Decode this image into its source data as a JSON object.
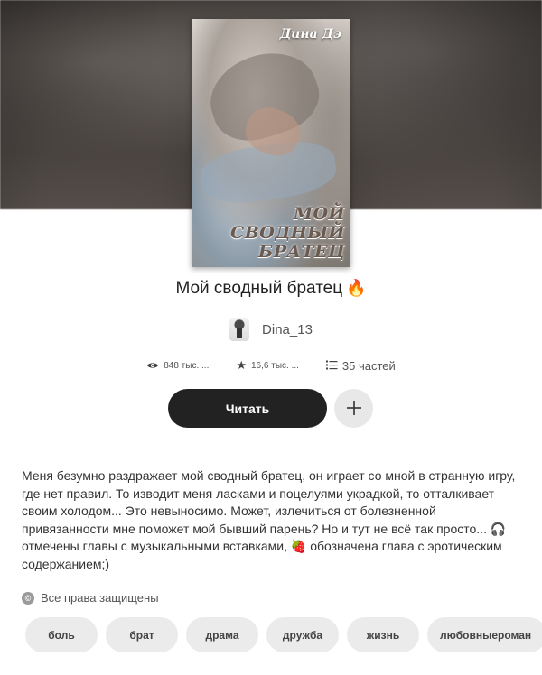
{
  "cover": {
    "author_text": "Дина Дэ",
    "title_lines": [
      "МОЙ",
      "СВОДНЫЙ",
      "БРАТЕЦ"
    ]
  },
  "story": {
    "title": "Мой сводный братец",
    "title_icon": "fire-emoji",
    "author": "Dina_13",
    "views": "848 тыс. ...",
    "votes": "16,6 тыс. ...",
    "parts": "35 частей",
    "read_label": "Читать",
    "add_icon": "plus-icon",
    "description": "Меня безумно раздражает мой сводный братец, он играет со мной в странную игру, где нет правил. То изводит меня ласками и поцелуями украдкой, то отталкивает своим холодом... Это невыносимо. Может, излечиться от болезненной привязанности мне поможет мой бывший парень? Но и тут не всё так просто... 🎧 отмечены главы с музыкальными вставками, 🍓 обозначена глава с эротическим содержанием;)",
    "copyright": "Все права защищены"
  },
  "tags": [
    "боль",
    "брат",
    "драма",
    "дружба",
    "жизнь",
    "любовныероман"
  ],
  "colors": {
    "read_button": "#222222",
    "add_button": "#e8e8e8",
    "tag_bg": "#ebebeb",
    "flame": "#f46a1f"
  }
}
